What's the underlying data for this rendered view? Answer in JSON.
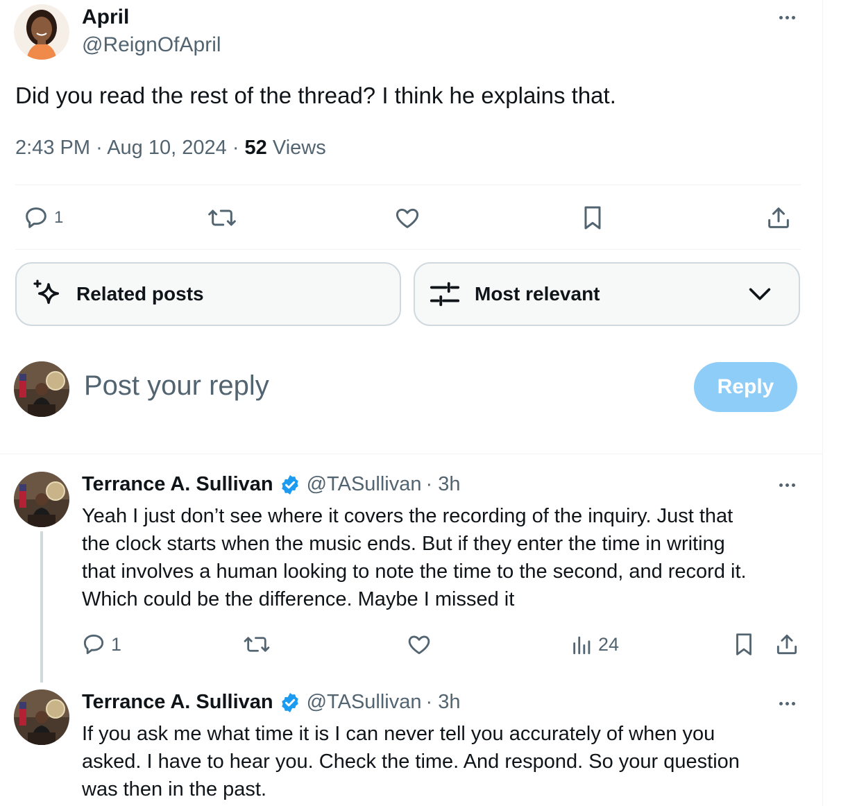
{
  "main_post": {
    "author_name": "April",
    "author_handle": "@ReignOfApril",
    "text": "Did you read the rest of the thread? I think he explains that.",
    "time": "2:43 PM",
    "date": "Aug 10, 2024",
    "separator": "·",
    "views_count": "52",
    "views_label": "Views",
    "reply_count": "1"
  },
  "filters": {
    "related_label": "Related posts",
    "sort_label": "Most relevant"
  },
  "composer": {
    "placeholder": "Post your reply",
    "reply_button": "Reply"
  },
  "replies": [
    {
      "author_name": "Terrance A. Sullivan",
      "author_handle": "@TASullivan",
      "time": "· 3h",
      "lines": [
        "Yeah I just don’t see where it covers the recording of the inquiry. Just that",
        "the clock starts when the music ends. But if they enter the time in writing",
        "that involves a human looking to note the time to the second, and record it.",
        "Which could be the difference. Maybe I missed it"
      ],
      "reply_count": "1",
      "view_count": "24"
    },
    {
      "author_name": "Terrance A. Sullivan",
      "author_handle": "@TASullivan",
      "time": "· 3h",
      "lines": [
        "If you ask me what time it is I can never tell you accurately of when you",
        "asked. I have to hear you. Check the time. And respond. So your question",
        "was then in the past."
      ]
    }
  ],
  "colors": {
    "accent": "#1d9bf0",
    "reply_button_disabled": "#8ecdf8",
    "secondary_text": "#536471",
    "border": "#eff3f4"
  },
  "icons": [
    "comment-icon",
    "retweet-icon",
    "like-icon",
    "bookmark-icon",
    "share-icon",
    "sparkle-icon",
    "sliders-icon",
    "chevron-down-icon",
    "views-icon",
    "verified-badge-icon",
    "more-icon"
  ]
}
